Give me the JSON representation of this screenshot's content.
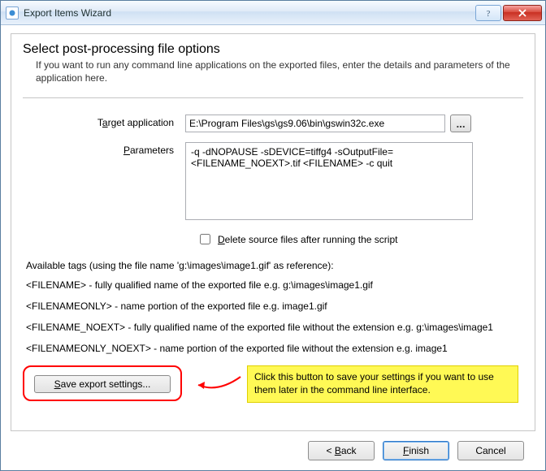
{
  "titlebar": {
    "title": "Export Items Wizard"
  },
  "heading": "Select post-processing file options",
  "description": "If you want to run any command line applications on the exported files, enter the details and parameters of the application here.",
  "form": {
    "target_label_pre": "T",
    "target_label_u": "a",
    "target_label_post": "rget application",
    "target_value": "E:\\Program Files\\gs\\gs9.06\\bin\\gswin32c.exe",
    "browse_label": "...",
    "params_label_u": "P",
    "params_label_post": "arameters",
    "params_value": "-q -dNOPAUSE -sDEVICE=tiffg4 -sOutputFile=<FILENAME_NOEXT>.tif <FILENAME> -c quit",
    "delete_checked": false,
    "delete_label_u": "D",
    "delete_label_post": "elete source files after running the script"
  },
  "tags": {
    "intro": "Available tags (using the file name 'g:\\images\\image1.gif' as reference):",
    "lines": [
      "<FILENAME> - fully qualified name of the exported file e.g. g:\\images\\image1.gif",
      "<FILENAMEONLY> - name portion of the exported file e.g. image1.gif",
      "<FILENAME_NOEXT> - fully qualified name of the exported file without the extension e.g. g:\\images\\image1",
      "<FILENAMEONLY_NOEXT> - name portion of the exported file without the extension e.g. image1"
    ]
  },
  "save_button_pre": "",
  "save_button_u": "S",
  "save_button_post": "ave export settings...",
  "callout_text": "Click this button to save your settings if you want to use them later in the command line interface.",
  "footer": {
    "back_pre": "< ",
    "back_u": "B",
    "back_post": "ack",
    "finish_u": "F",
    "finish_post": "inish",
    "cancel": "Cancel"
  }
}
